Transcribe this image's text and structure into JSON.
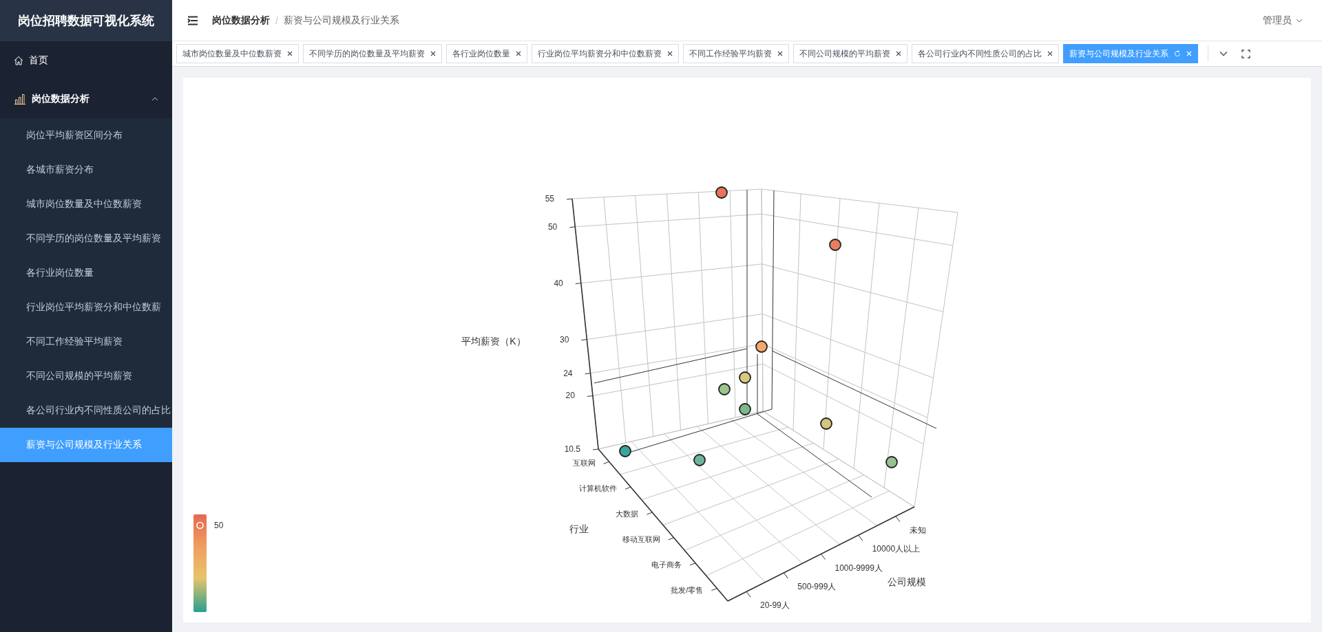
{
  "sidebar": {
    "title": "岗位招聘数据可视化系统",
    "items": [
      {
        "label": "首页",
        "kind": "link",
        "selected": false
      },
      {
        "label": "岗位数据分析",
        "kind": "group",
        "expanded": true,
        "children": [
          {
            "label": "岗位平均薪资区间分布",
            "selected": false
          },
          {
            "label": "各城市薪资分布",
            "selected": false
          },
          {
            "label": "城市岗位数量及中位数薪资",
            "selected": false
          },
          {
            "label": "不同学历的岗位数量及平均薪资",
            "selected": false
          },
          {
            "label": "各行业岗位数量",
            "selected": false
          },
          {
            "label": "行业岗位平均薪资分和中位数薪",
            "selected": false
          },
          {
            "label": "不同工作经验平均薪资",
            "selected": false
          },
          {
            "label": "不同公司规模的平均薪资",
            "selected": false
          },
          {
            "label": "各公司行业内不同性质公司的占比",
            "selected": false
          },
          {
            "label": "薪资与公司规模及行业关系",
            "selected": true
          }
        ]
      }
    ]
  },
  "header": {
    "breadcrumb": [
      "岗位数据分析",
      "薪资与公司规模及行业关系"
    ],
    "separator": "/",
    "user": "管理员"
  },
  "tags": [
    {
      "label": "城市岗位数量及中位数薪资",
      "selected": false
    },
    {
      "label": "不同学历的岗位数量及平均薪资",
      "selected": false
    },
    {
      "label": "各行业岗位数量",
      "selected": false
    },
    {
      "label": "行业岗位平均薪资分和中位数薪资",
      "selected": false
    },
    {
      "label": "不同工作经验平均薪资",
      "selected": false
    },
    {
      "label": "不同公司规模的平均薪资",
      "selected": false
    },
    {
      "label": "各公司行业内不同性质公司的占比",
      "selected": false
    },
    {
      "label": "薪资与公司规模及行业关系",
      "selected": true
    }
  ],
  "chart": {
    "y_axis": {
      "name": "平均薪资（K）",
      "ticks": [
        "55",
        "50",
        "40",
        "30",
        "24",
        "20",
        "10.5"
      ]
    },
    "industry_axis": {
      "name": "行业",
      "labels": [
        "互联网",
        "计算机软件",
        "大数据",
        "移动互联网",
        "电子商务",
        "批发/零售"
      ]
    },
    "size_axis": {
      "name": "公司规模",
      "labels": [
        "20-99人",
        "500-999人",
        "1000-9999人",
        "10000人以上",
        "未知"
      ]
    },
    "legend": {
      "label": "50"
    }
  }
}
